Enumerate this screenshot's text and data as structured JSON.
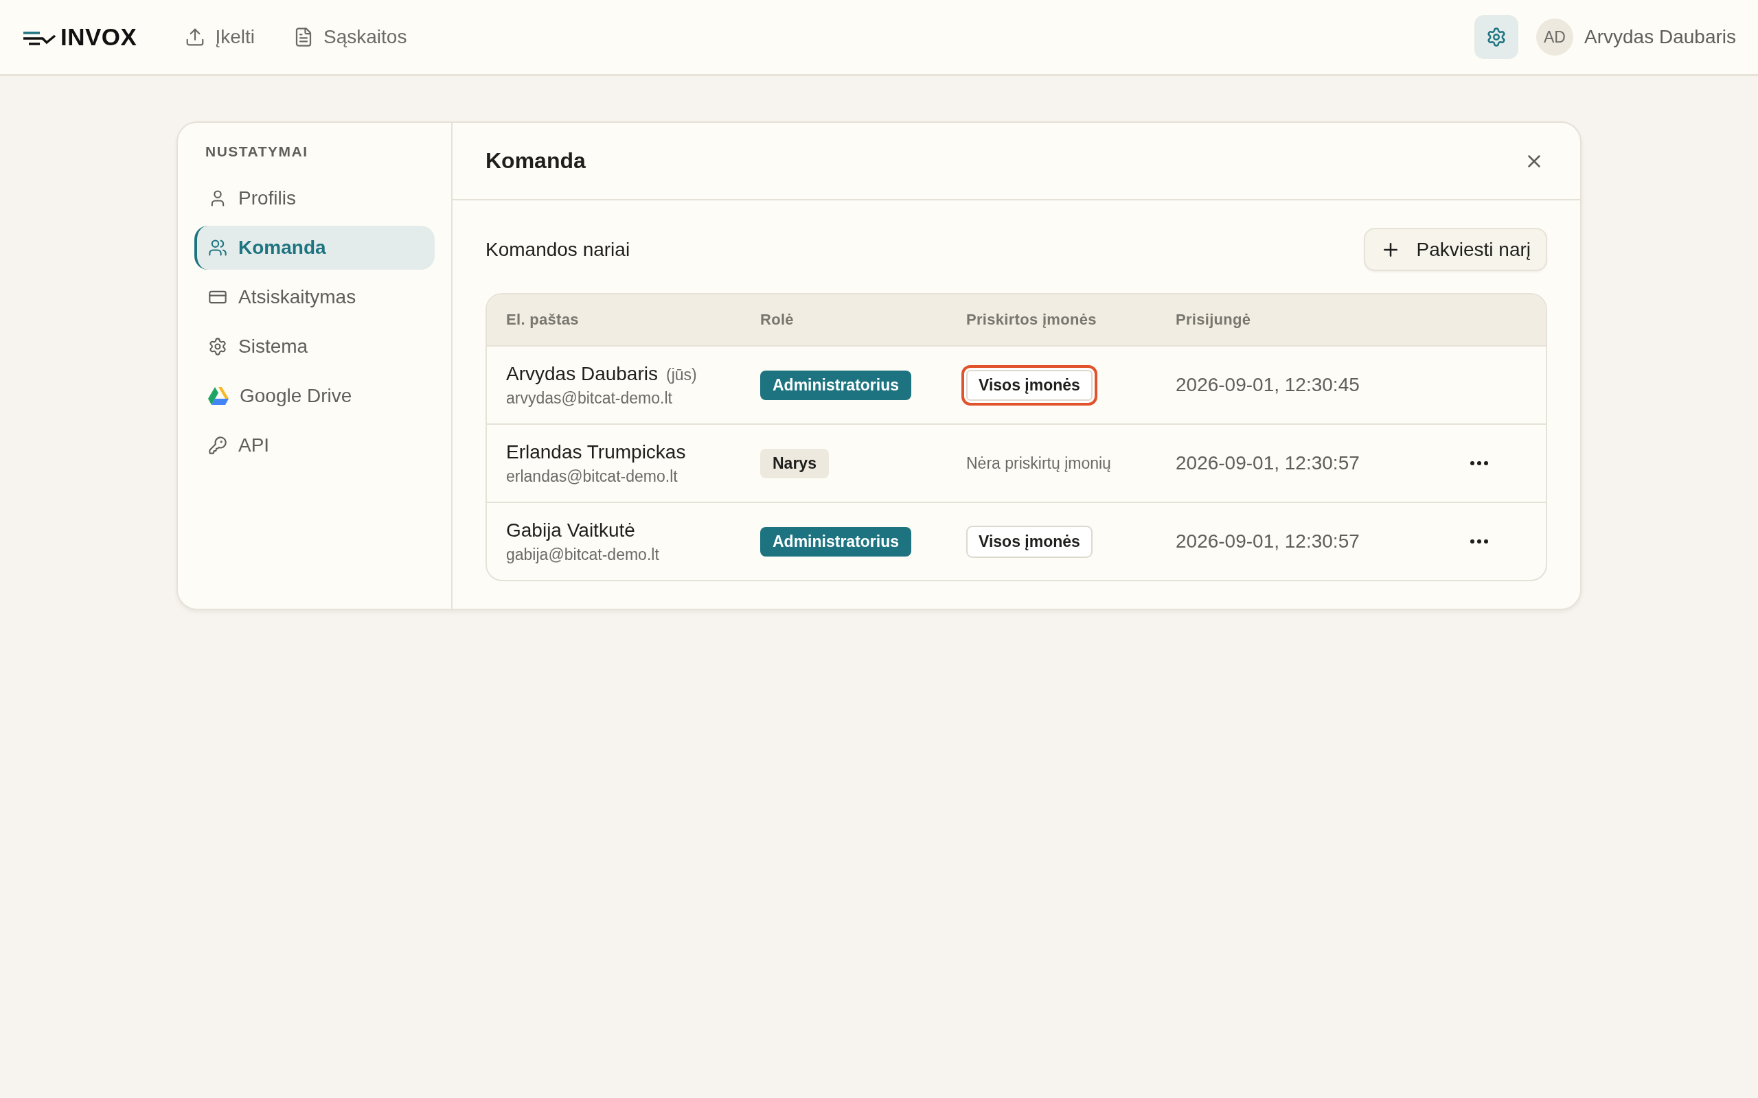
{
  "header": {
    "logo": "INVOX",
    "nav": [
      {
        "label": "Įkelti"
      },
      {
        "label": "Sąskaitos"
      }
    ],
    "settings_selected": true,
    "user": {
      "initials": "AD",
      "name": "Arvydas Daubaris"
    }
  },
  "sidebar": {
    "heading": "NUSTATYMAI",
    "items": [
      {
        "label": "Profilis",
        "selected": false
      },
      {
        "label": "Komanda",
        "selected": true
      },
      {
        "label": "Atsiskaitymas",
        "selected": false
      },
      {
        "label": "Sistema",
        "selected": false
      },
      {
        "label": "Google Drive",
        "selected": false
      },
      {
        "label": "API",
        "selected": false
      }
    ]
  },
  "panel": {
    "title": "Komanda",
    "section_title": "Komandos nariai",
    "invite_button": "Pakviesti narį",
    "table": {
      "columns": [
        "El. paštas",
        "Rolė",
        "Priskirtos įmonės",
        "Prisijungė"
      ],
      "rows": [
        {
          "name": "Arvydas Daubaris",
          "you_label": "(jūs)",
          "email": "arvydas@bitcat-demo.lt",
          "role": {
            "kind": "admin",
            "label": "Administratorius"
          },
          "companies": {
            "kind": "button",
            "label": "Visos įmonės",
            "focused": true
          },
          "last_login": "2026-09-01, 12:30:45",
          "menu": false
        },
        {
          "name": "Erlandas Trumpickas",
          "email": "erlandas@bitcat-demo.lt",
          "role": {
            "kind": "member",
            "label": "Narys"
          },
          "companies": {
            "kind": "text",
            "label": "Nėra priskirtų įmonių"
          },
          "last_login": "2026-09-01, 12:30:57",
          "menu": true
        },
        {
          "name": "Gabija Vaitkutė",
          "email": "gabija@bitcat-demo.lt",
          "role": {
            "kind": "admin",
            "label": "Administratorius"
          },
          "companies": {
            "kind": "button",
            "label": "Visos įmonės",
            "focused": false
          },
          "last_login": "2026-09-01, 12:30:57",
          "menu": true
        }
      ]
    }
  }
}
